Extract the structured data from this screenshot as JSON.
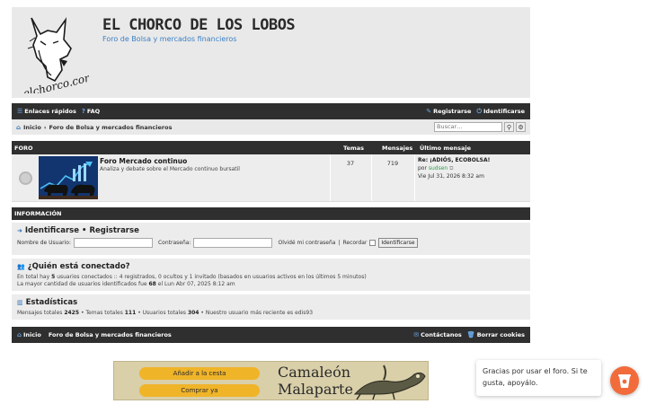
{
  "header": {
    "site_title": "EL CHORCO DE LOS LOBOS",
    "site_description": "Foro de Bolsa y mercados financieros",
    "logo_text": "elchorco.com"
  },
  "navbar": {
    "quick_links": "Enlaces rápidos",
    "faq": "FAQ",
    "register": "Registrarse",
    "login": "Identificarse"
  },
  "breadcrumb": {
    "home": "Inicio",
    "forum": "Foro de Bolsa y mercados financieros"
  },
  "search": {
    "placeholder": "Buscar…"
  },
  "forum_table": {
    "columns": {
      "forum": "FORO",
      "topics": "Temas",
      "posts": "Mensajes",
      "last_post": "Último mensaje"
    },
    "rows": [
      {
        "title": "Foro Mercado continuo",
        "description": "Analiza y debate sobre el Mercado continuo bursatil",
        "topics": "37",
        "posts": "719",
        "last_title": "Re: ¡ADIÓS, ECOBOLSA!",
        "last_by": "por",
        "last_user": "sudsen",
        "last_date": "Vie Jul 31, 2026 8:32 am"
      }
    ]
  },
  "info": {
    "section_title": "INFORMACIÓN",
    "login_heading_a": "Identificarse",
    "login_heading_sep": "•",
    "login_heading_b": "Registrarse",
    "username_label": "Nombre de Usuario:",
    "password_label": "Contraseña:",
    "forgot_label": "Olvidé mi contraseña",
    "remember_sep": "|",
    "remember_label": "Recordar",
    "login_button": "Identificarse",
    "online_heading": "¿Quién está conectado?",
    "online_line1_a": "En total hay",
    "online_count": "5",
    "online_line1_b": "usuarios conectados :: 4 registrados, 0 ocultos y 1 invitado (basados en usuarios activos en los últimos 5 minutos)",
    "online_line2_a": "La mayor cantidad de usuarios identificados fue",
    "online_max": "68",
    "online_line2_b": "el Lun Abr 07, 2025 8:12 am",
    "stats_heading": "Estadísticas",
    "stats_posts_label": "Mensajes totales",
    "stats_posts": "2425",
    "stats_topics_label": "• Temas totales",
    "stats_topics": "111",
    "stats_users_label": "• Usuarios totales",
    "stats_users": "304",
    "stats_newest_label": "• Nuestro usuario más reciente es",
    "stats_newest": "edis93"
  },
  "footer": {
    "home": "Inicio",
    "forum": "Foro de Bolsa y mercados financieros",
    "contact": "Contáctanos",
    "delete_cookies": "Borrar cookies"
  },
  "ad": {
    "add_to_cart": "Añadir a la cesta",
    "buy_now": "Comprar ya",
    "brand_line1": "Camaleón",
    "brand_line2": "Malaparte"
  },
  "donate": {
    "message": "Gracias por usar el foro. Si te gusta, apoyálo."
  },
  "colors": {
    "dark_bar": "#2f2f2f",
    "panel": "#e9e9e9",
    "link_blue": "#3a7fc4",
    "user_green": "#2e9c4a",
    "donate_orange": "#f26b3a",
    "ad_button": "#f0b429"
  }
}
